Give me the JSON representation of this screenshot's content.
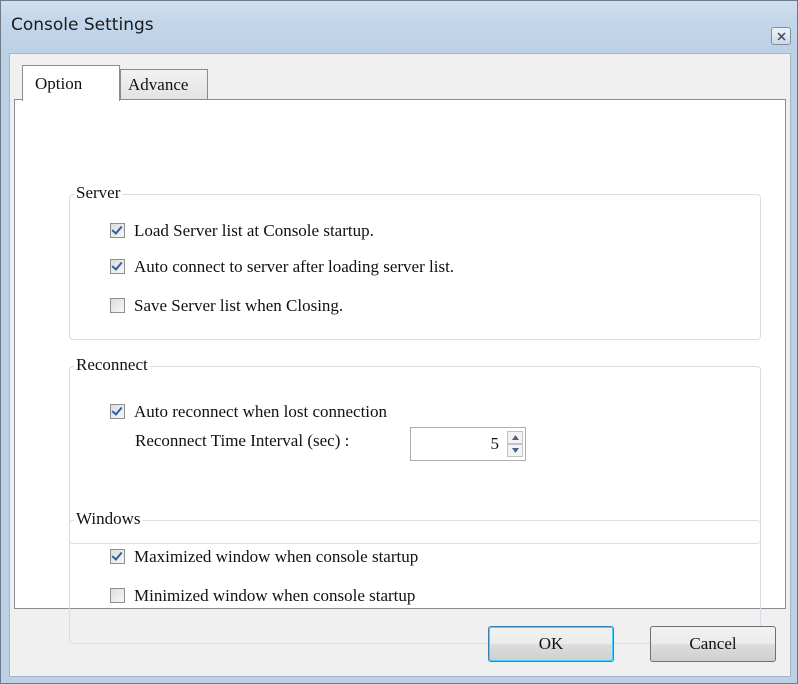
{
  "window": {
    "title": "Console Settings"
  },
  "tabs": [
    {
      "label": "Option",
      "active": true
    },
    {
      "label": "Advance",
      "active": false
    }
  ],
  "server_group": {
    "title": "Server",
    "items": [
      {
        "label": "Load Server list at Console startup.",
        "checked": true
      },
      {
        "label": "Auto connect to server after loading server list.",
        "checked": true
      },
      {
        "label": "Save Server list when Closing.",
        "checked": false
      }
    ]
  },
  "reconnect_group": {
    "title": "Reconnect",
    "auto_reconnect": {
      "label": "Auto reconnect when lost connection",
      "checked": true
    },
    "interval_label": "Reconnect Time Interval (sec) :",
    "interval_value": "5"
  },
  "windows_group": {
    "title": "Windows",
    "items": [
      {
        "label": "Maximized window when console startup",
        "checked": true
      },
      {
        "label": "Minimized window when console startup",
        "checked": false
      }
    ]
  },
  "buttons": {
    "ok": "OK",
    "cancel": "Cancel"
  },
  "colors": {
    "check_accent": "#2a5fa8",
    "titlebar": "#c4d6ea",
    "dialog_face": "#f0f0f0"
  }
}
